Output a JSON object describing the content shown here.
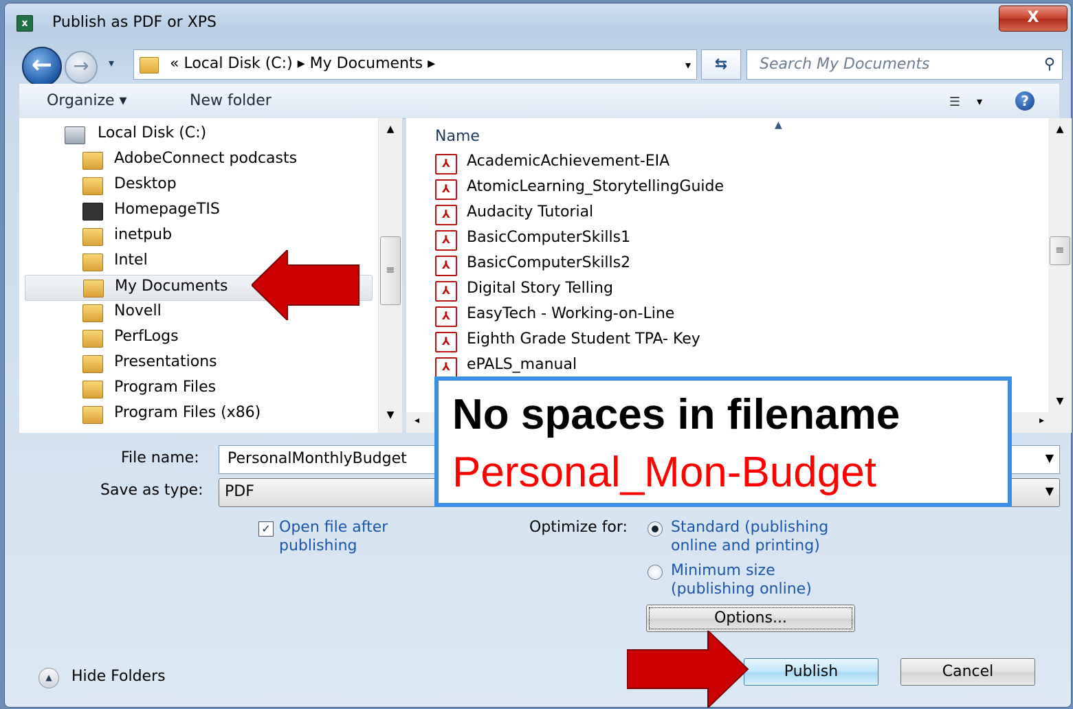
{
  "window": {
    "title": "Publish as PDF or XPS",
    "app_icon": "excel-icon",
    "close_label": "X"
  },
  "address": {
    "crumbs": "« Local Disk (C:) ▸ My Documents ▸",
    "search_placeholder": "Search My Documents"
  },
  "toolbar": {
    "organize": "Organize ▾",
    "new_folder": "New folder"
  },
  "nav": {
    "items": [
      {
        "label": "Local Disk (C:)",
        "icon": "drive-icon"
      },
      {
        "label": "AdobeConnect podcasts",
        "icon": "folder-icon"
      },
      {
        "label": "Desktop",
        "icon": "folder-icon"
      },
      {
        "label": "HomepageTIS",
        "icon": "camera-folder-icon"
      },
      {
        "label": "inetpub",
        "icon": "folder-icon"
      },
      {
        "label": "Intel",
        "icon": "folder-icon"
      },
      {
        "label": "My Documents",
        "icon": "folder-icon",
        "selected": true
      },
      {
        "label": "Novell",
        "icon": "folder-icon"
      },
      {
        "label": "PerfLogs",
        "icon": "folder-icon"
      },
      {
        "label": "Presentations",
        "icon": "folder-icon"
      },
      {
        "label": "Program Files",
        "icon": "folder-icon"
      },
      {
        "label": "Program Files (x86)",
        "icon": "folder-icon"
      }
    ]
  },
  "files": {
    "column": "Name",
    "items": [
      "AcademicAchievement-EIA",
      "AtomicLearning_StorytellingGuide",
      "Audacity Tutorial",
      "BasicComputerSkills1",
      "BasicComputerSkills2",
      "Digital Story Telling",
      "EasyTech - Working-on-Line",
      "Eighth Grade Student TPA- Key",
      "ePALS_manual"
    ]
  },
  "form": {
    "file_name_label": "File name:",
    "file_name_value": "PersonalMonthlyBudget",
    "save_type_label": "Save as type:",
    "save_type_value": "PDF",
    "open_after_line1": "Open file after",
    "open_after_line2": "publishing",
    "open_after_checked": true,
    "optimize_label": "Optimize for:",
    "standard_line1": "Standard (publishing",
    "standard_line2": "online and printing)",
    "minimum_line1": "Minimum size",
    "minimum_line2": "(publishing online)",
    "options": "Options...",
    "publish": "Publish",
    "cancel": "Cancel",
    "hide_folders": "Hide Folders"
  },
  "callout": {
    "line1": "No spaces in filename",
    "line2": "Personal_Mon-Budget",
    "border_color": "#3a8fe6",
    "line2_color": "#ff0000"
  },
  "annotation_color": "#cc0000"
}
